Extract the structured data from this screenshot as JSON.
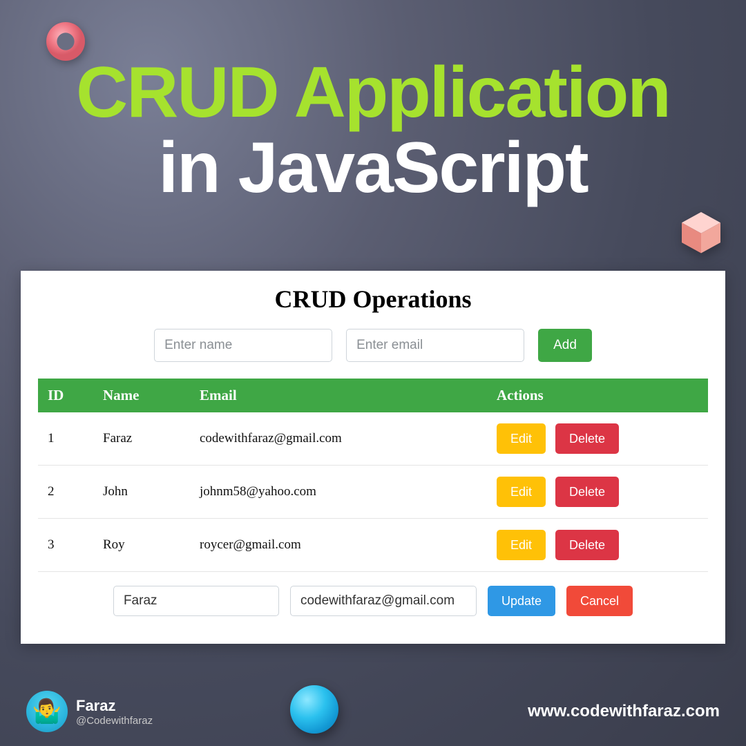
{
  "hero": {
    "line1": "CRUD Application",
    "line2": "in JavaScript"
  },
  "app": {
    "title": "CRUD Operations",
    "name_placeholder": "Enter name",
    "email_placeholder": "Enter email",
    "add_label": "Add",
    "headers": {
      "id": "ID",
      "name": "Name",
      "email": "Email",
      "actions": "Actions"
    },
    "rows": [
      {
        "id": "1",
        "name": "Faraz",
        "email": "codewithfaraz@gmail.com"
      },
      {
        "id": "2",
        "name": "John",
        "email": "johnm58@yahoo.com"
      },
      {
        "id": "3",
        "name": "Roy",
        "email": "roycer@gmail.com"
      }
    ],
    "edit_label": "Edit",
    "delete_label": "Delete",
    "editing": {
      "name": "Faraz",
      "email": "codewithfaraz@gmail.com",
      "update_label": "Update",
      "cancel_label": "Cancel"
    }
  },
  "footer": {
    "author_name": "Faraz",
    "author_handle": "@Codewithfaraz",
    "site_url": "www.codewithfaraz.com"
  },
  "colors": {
    "accent_green": "#a6e22e",
    "button_green": "#3fa745",
    "button_yellow": "#ffc107",
    "button_red": "#dc3545",
    "button_blue": "#2f98e5",
    "button_orange": "#f14a39"
  }
}
